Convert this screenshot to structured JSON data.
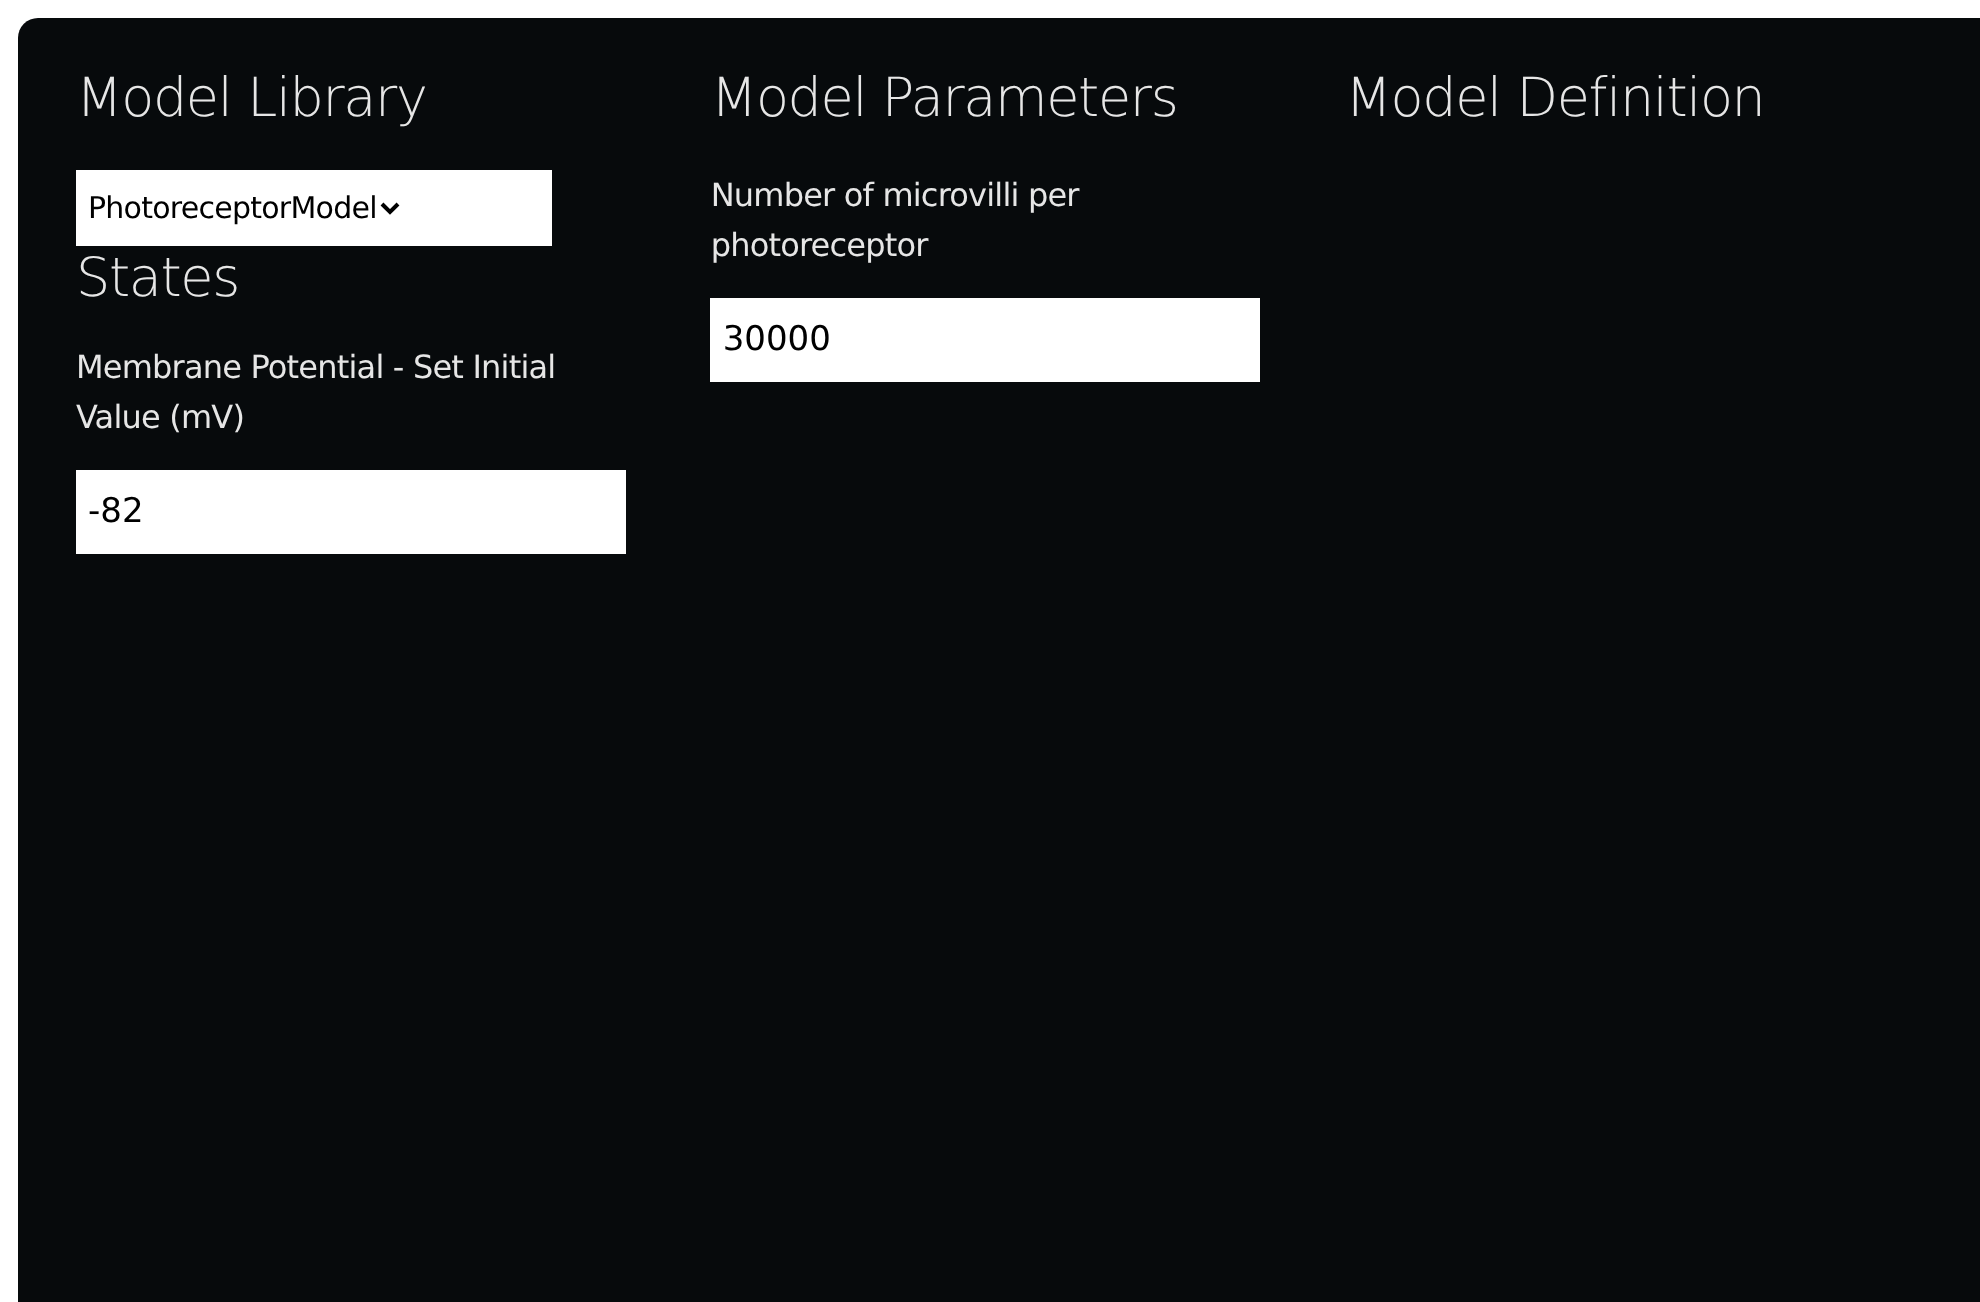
{
  "columns": [
    {
      "heading": "Model Library",
      "select": {
        "value": "PhotoreceptorModel"
      },
      "subheading": "States",
      "fields": [
        {
          "label": "Membrane Potential - Set Initial Value (mV)",
          "value": "-82"
        }
      ]
    },
    {
      "heading": "Model Parameters",
      "fields": [
        {
          "label": "Number of microvilli per photoreceptor",
          "value": "30000"
        }
      ]
    },
    {
      "heading": "Model Definition"
    }
  ]
}
